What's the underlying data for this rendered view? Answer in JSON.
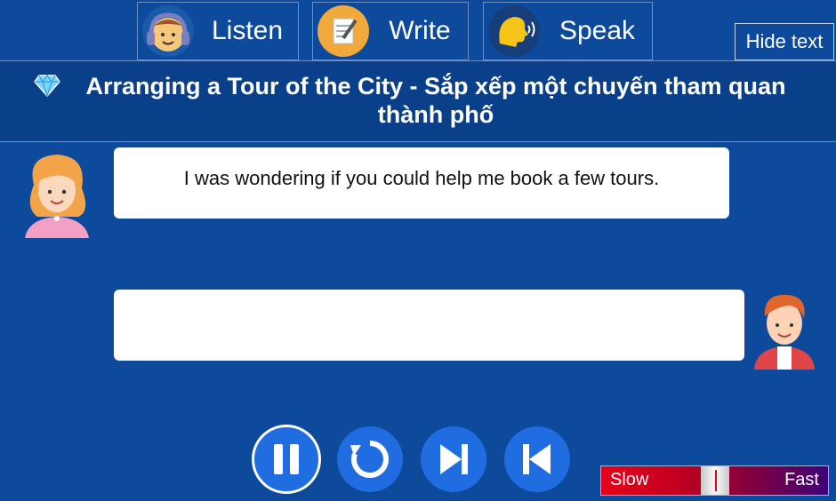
{
  "tabs": [
    {
      "label": "Listen",
      "icon": "headphones-face-icon"
    },
    {
      "label": "Write",
      "icon": "notepad-pencil-icon"
    },
    {
      "label": "Speak",
      "icon": "speaking-head-icon"
    }
  ],
  "hide_text_label": "Hide text",
  "lesson_title": "Arranging a Tour of the City - Sắp xếp một chuyến tham quan thành phố",
  "dialogue": [
    {
      "speaker": "girl",
      "text": "I was wondering if you could help me book a few tours."
    },
    {
      "speaker": "boy",
      "text": ""
    }
  ],
  "controls": [
    "pause-button",
    "replay-button",
    "next-button",
    "previous-button"
  ],
  "speed": {
    "slow_label": "Slow",
    "fast_label": "Fast",
    "level": 0.5
  },
  "colors": {
    "background": "#0d4a9c",
    "control": "#1f6de0",
    "speed_start": "#e6001a",
    "speed_end": "#3e0077"
  }
}
